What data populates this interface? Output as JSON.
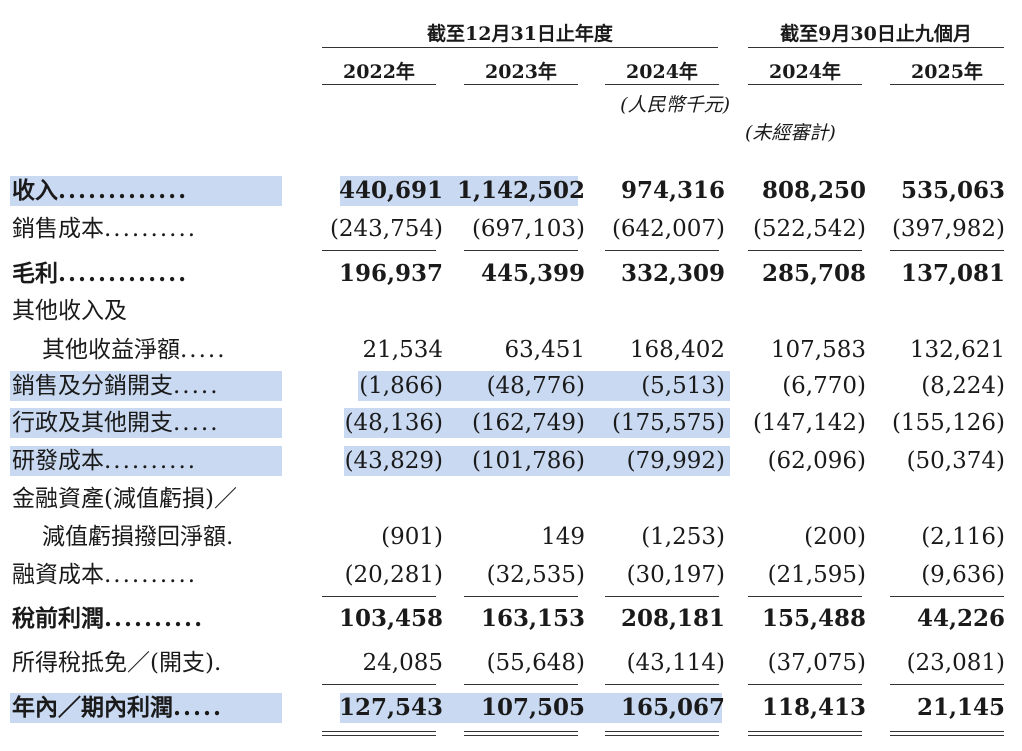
{
  "header": {
    "group1_title": "截至12月31日止年度",
    "group2_title": "截至9月30日止九個月",
    "years": [
      "2022年",
      "2023年",
      "2024年",
      "2024年",
      "2025年"
    ],
    "unit_note": "(人民幣千元)",
    "unaudited_note": "(未經審計)"
  },
  "rows": [
    {
      "label": "收入",
      "dots": ".............",
      "values": [
        "440,691",
        "1,142,502",
        "974,316",
        "808,250",
        "535,063"
      ],
      "bold": true
    },
    {
      "label": "銷售成本",
      "dots": "..........",
      "values": [
        "(243,754)",
        "(697,103)",
        "(642,007)",
        "(522,542)",
        "(397,982)"
      ],
      "bold": false
    },
    {
      "label": "毛利",
      "dots": ".............",
      "values": [
        "196,937",
        "445,399",
        "332,309",
        "285,708",
        "137,081"
      ],
      "bold": true
    },
    {
      "label": "其他收入及",
      "dots": "",
      "values": [
        "",
        "",
        "",
        "",
        ""
      ],
      "bold": false
    },
    {
      "label": "其他收益淨額",
      "dots": ".....",
      "values": [
        "21,534",
        "63,451",
        "168,402",
        "107,583",
        "132,621"
      ],
      "bold": false
    },
    {
      "label": "銷售及分銷開支",
      "dots": ".....",
      "values": [
        "(1,866)",
        "(48,776)",
        "(5,513)",
        "(6,770)",
        "(8,224)"
      ],
      "bold": false
    },
    {
      "label": "行政及其他開支",
      "dots": ".....",
      "values": [
        "(48,136)",
        "(162,749)",
        "(175,575)",
        "(147,142)",
        "(155,126)"
      ],
      "bold": false
    },
    {
      "label": "研發成本",
      "dots": "..........",
      "values": [
        "(43,829)",
        "(101,786)",
        "(79,992)",
        "(62,096)",
        "(50,374)"
      ],
      "bold": false
    },
    {
      "label": "金融資產(減值虧損)／",
      "dots": "",
      "values": [
        "",
        "",
        "",
        "",
        ""
      ],
      "bold": false
    },
    {
      "label": "減值虧損撥回淨額",
      "dots": ".",
      "values": [
        "(901)",
        "149",
        "(1,253)",
        "(200)",
        "(2,116)"
      ],
      "bold": false
    },
    {
      "label": "融資成本",
      "dots": "..........",
      "values": [
        "(20,281)",
        "(32,535)",
        "(30,197)",
        "(21,595)",
        "(9,636)"
      ],
      "bold": false
    },
    {
      "label": "稅前利潤",
      "dots": "..........",
      "values": [
        "103,458",
        "163,153",
        "208,181",
        "155,488",
        "44,226"
      ],
      "bold": true
    },
    {
      "label": "所得稅抵免／(開支)",
      "dots": ".",
      "values": [
        "24,085",
        "(55,648)",
        "(43,114)",
        "(37,075)",
        "(23,081)"
      ],
      "bold": false
    },
    {
      "label": "年內／期內利潤",
      "dots": ".....",
      "values": [
        "127,543",
        "107,505",
        "165,067",
        "118,413",
        "21,145"
      ],
      "bold": true
    }
  ]
}
